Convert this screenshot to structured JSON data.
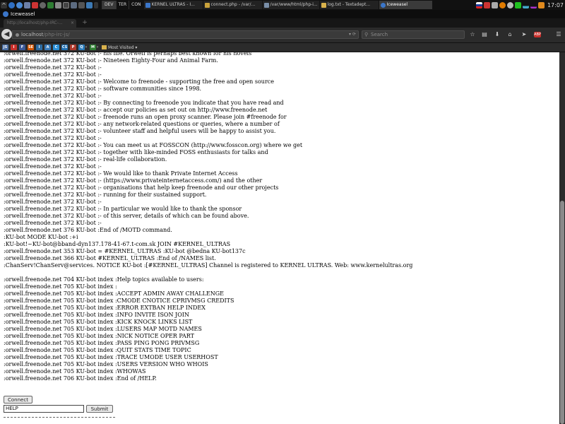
{
  "panel": {
    "labels": [
      "DEV",
      "TER",
      "CON"
    ],
    "tasks": [
      {
        "label": "KERNEL ULTRAS - I..."
      },
      {
        "label": "connect.php - /var/..."
      },
      {
        "label": "/var/www/html/php-i..."
      },
      {
        "label": "log.txt - Textadept..."
      },
      {
        "label": "Iceweasel"
      }
    ],
    "clock": "17:07"
  },
  "window": {
    "title": "Iceweasel"
  },
  "tab": {
    "title": "http://localhost/php-IRC-..."
  },
  "navbar": {
    "url_host": "localhost",
    "url_path": "/php-irc-js/",
    "search_placeholder": "Search"
  },
  "bookmarks": {
    "items": [
      "JS",
      "I",
      "F",
      "SE",
      "I",
      "A",
      "C",
      "CS",
      "P",
      "Q",
      "M"
    ],
    "most_visited": "Most Visited ▾"
  },
  "log_lines": [
    ":orwell.freenode.net 372 KU-bot :- his life. Orwell is perhaps best known for his novels",
    ":orwell.freenode.net 372 KU-bot :- Nineteen Eighty-Four and Animal Farm.",
    ":orwell.freenode.net 372 KU-bot :-",
    ":orwell.freenode.net 372 KU-bot :-",
    ":orwell.freenode.net 372 KU-bot :- Welcome to freenode - supporting the free and open source",
    ":orwell.freenode.net 372 KU-bot :- software communities since 1998.",
    ":orwell.freenode.net 372 KU-bot :-",
    ":orwell.freenode.net 372 KU-bot :- By connecting to freenode you indicate that you have read and",
    ":orwell.freenode.net 372 KU-bot :- accept our policies as set out on http://www.freenode.net",
    ":orwell.freenode.net 372 KU-bot :- freenode runs an open proxy scanner. Please join #freenode for",
    ":orwell.freenode.net 372 KU-bot :- any network-related questions or queries, where a number of",
    ":orwell.freenode.net 372 KU-bot :- volunteer staff and helpful users will be happy to assist you.",
    ":orwell.freenode.net 372 KU-bot :-",
    ":orwell.freenode.net 372 KU-bot :- You can meet us at FOSSCON (http://www.fosscon.org) where we get",
    ":orwell.freenode.net 372 KU-bot :- together with like-minded FOSS enthusiasts for talks and",
    ":orwell.freenode.net 372 KU-bot :- real-life collaboration.",
    ":orwell.freenode.net 372 KU-bot :-",
    ":orwell.freenode.net 372 KU-bot :- We would like to thank Private Internet Access",
    ":orwell.freenode.net 372 KU-bot :- (https://www.privateinternetaccess.com/) and the other",
    ":orwell.freenode.net 372 KU-bot :- organisations that help keep freenode and our other projects",
    ":orwell.freenode.net 372 KU-bot :- running for their sustained support.",
    ":orwell.freenode.net 372 KU-bot :-",
    ":orwell.freenode.net 372 KU-bot :- In particular we would like to thank the sponsor",
    ":orwell.freenode.net 372 KU-bot :- of this server, details of which can be found above.",
    ":orwell.freenode.net 372 KU-bot :-",
    ":orwell.freenode.net 376 KU-bot :End of /MOTD command.",
    ":KU-bot MODE KU-bot :+i",
    ":KU-bot!~KU-bot@bband-dyn137.178-41-67.t-com.sk JOIN #KERNEL_ULTRAS",
    ":orwell.freenode.net 353 KU-bot = #KERNEL_ULTRAS :KU-bot @bedna KU-bot137c",
    ":orwell.freenode.net 366 KU-bot #KERNEL_ULTRAS :End of /NAMES list.",
    ":ChanServ!ChanServ@services. NOTICE KU-bot :[#KERNEL_ULTRAS] Channel is registered to KERNEL ULTRAS. Web: www.kernelultras.org",
    "",
    ":orwell.freenode.net 704 KU-bot index :Help topics available to users:",
    ":orwell.freenode.net 705 KU-bot index :",
    ":orwell.freenode.net 705 KU-bot index :ACCEPT ADMIN AWAY CHALLENGE",
    ":orwell.freenode.net 705 KU-bot index :CMODE CNOTICE CPRIVMSG CREDITS",
    ":orwell.freenode.net 705 KU-bot index :ERROR EXTBAN HELP INDEX",
    ":orwell.freenode.net 705 KU-bot index :INFO INVITE ISON JOIN",
    ":orwell.freenode.net 705 KU-bot index :KICK KNOCK LINKS LIST",
    ":orwell.freenode.net 705 KU-bot index :LUSERS MAP MOTD NAMES",
    ":orwell.freenode.net 705 KU-bot index :NICK NOTICE OPER PART",
    ":orwell.freenode.net 705 KU-bot index :PASS PING PONG PRIVMSG",
    ":orwell.freenode.net 705 KU-bot index :QUIT STATS TIME TOPIC",
    ":orwell.freenode.net 705 KU-bot index :TRACE UMODE USER USERHOST",
    ":orwell.freenode.net 705 KU-bot index :USERS VERSION WHO WHOIS",
    ":orwell.freenode.net 705 KU-bot index :WHOWAS",
    ":orwell.freenode.net 706 KU-bot index :End of /HELP."
  ],
  "form": {
    "connect_label": "Connect",
    "input_value": "HELP",
    "submit_label": "Submit"
  },
  "colors": {
    "page_bg": "#ffffff",
    "chrome_bg": "#2b2b2b",
    "panel_bg": "#111111"
  }
}
